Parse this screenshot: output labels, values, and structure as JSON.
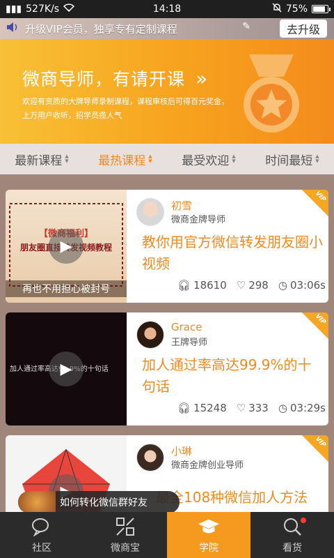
{
  "status_bar": {
    "network_speed": "527K/s",
    "time": "14:18",
    "battery": "75%"
  },
  "vip_banner": {
    "text": "升级VIP会员，独享专有定制课程",
    "button": "去升级"
  },
  "hero": {
    "title": "微商导师，有请开课",
    "arrow": "»",
    "desc": "欢迎有资质的大牌导师录制课程，课程审核后可得百元奖金，上万用户收听，招学员揽人气"
  },
  "tabs": [
    {
      "label": "最新课程",
      "active": false
    },
    {
      "label": "最热课程",
      "active": true
    },
    {
      "label": "最受欢迎",
      "active": false
    },
    {
      "label": "时间最短",
      "active": false
    }
  ],
  "courses": [
    {
      "author": "初雪",
      "role": "微商金牌导师",
      "title": "教你用官方微信转发朋友圈小视频",
      "listens": "18610",
      "likes": "298",
      "duration": "03:06s",
      "badge": "VIP",
      "thumb": {
        "stamp": "【微商福利】",
        "headline": "朋友圈直接转发视频教程",
        "footer": "再也不用担心被封号"
      }
    },
    {
      "author": "Grace",
      "role": "王牌导师",
      "title": "加人通过率高达99.9%的十句话",
      "listens": "15248",
      "likes": "333",
      "duration": "03:29s",
      "badge": "VIP",
      "thumb": {
        "caption": "加人通过率高达99.9%的十句话"
      }
    },
    {
      "author": "小琳",
      "role": "微商金牌创业导师",
      "title": "最全108种微信加人方法",
      "badge": "VIP"
    }
  ],
  "toast": {
    "text": "如何转化微信群好友"
  },
  "bottom_nav": [
    {
      "label": "社区",
      "icon": "chat-icon",
      "active": false
    },
    {
      "label": "微商宝",
      "icon": "grid-icon",
      "active": false
    },
    {
      "label": "学院",
      "icon": "graduation-cap-icon",
      "active": true
    },
    {
      "label": "看货",
      "icon": "search-goods-icon",
      "active": false
    }
  ],
  "colors": {
    "accent": "#f08a1f",
    "hero_start": "#f8c036",
    "hero_end": "#f48b1c",
    "nav_bg": "#2b2b2b"
  }
}
